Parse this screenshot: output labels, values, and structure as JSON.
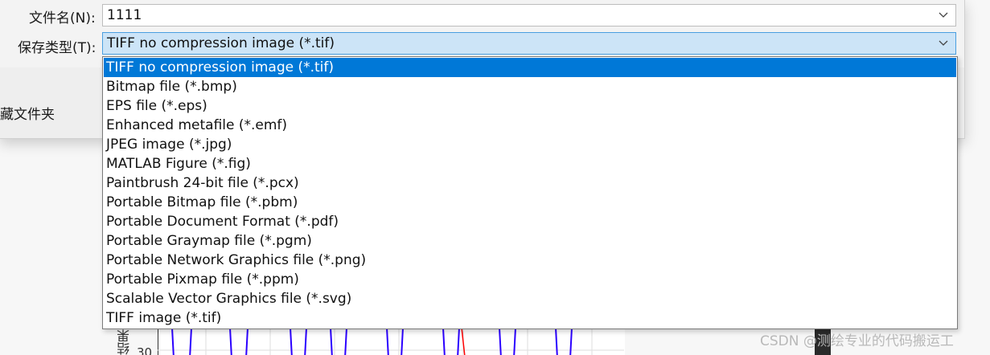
{
  "dialog": {
    "filename_label": "文件名(N):",
    "filename_value": "1111",
    "savetype_label": "保存类型(T):",
    "savetype_value": "TIFF no compression image (*.tif)",
    "hide_folders_label": "藏文件夹"
  },
  "dropdown": {
    "selected_index": 0,
    "options": [
      "TIFF no compression image (*.tif)",
      "Bitmap file (*.bmp)",
      "EPS file (*.eps)",
      "Enhanced metafile (*.emf)",
      "JPEG image (*.jpg)",
      "MATLAB Figure (*.fig)",
      "Paintbrush 24-bit file (*.pcx)",
      "Portable Bitmap file (*.pbm)",
      "Portable Document Format (*.pdf)",
      "Portable Graymap file (*.pgm)",
      "Portable Network Graphics file (*.png)",
      "Portable Pixmap file (*.ppm)",
      "Scalable Vector Graphics file (*.svg)",
      "TIFF image (*.tif)"
    ]
  },
  "background_figure": {
    "ylabel_fragment": "结果",
    "ytick_label": "30"
  },
  "watermark": "CSDN @测绘专业的代码搬运工",
  "icons": {
    "combo_arrow": "chevron-down-icon"
  },
  "colors": {
    "selection_blue": "#0078d7",
    "combo_highlight": "#cce4f7",
    "plot_line_blue": "#2b00ff",
    "plot_line_red": "#ff0000"
  }
}
